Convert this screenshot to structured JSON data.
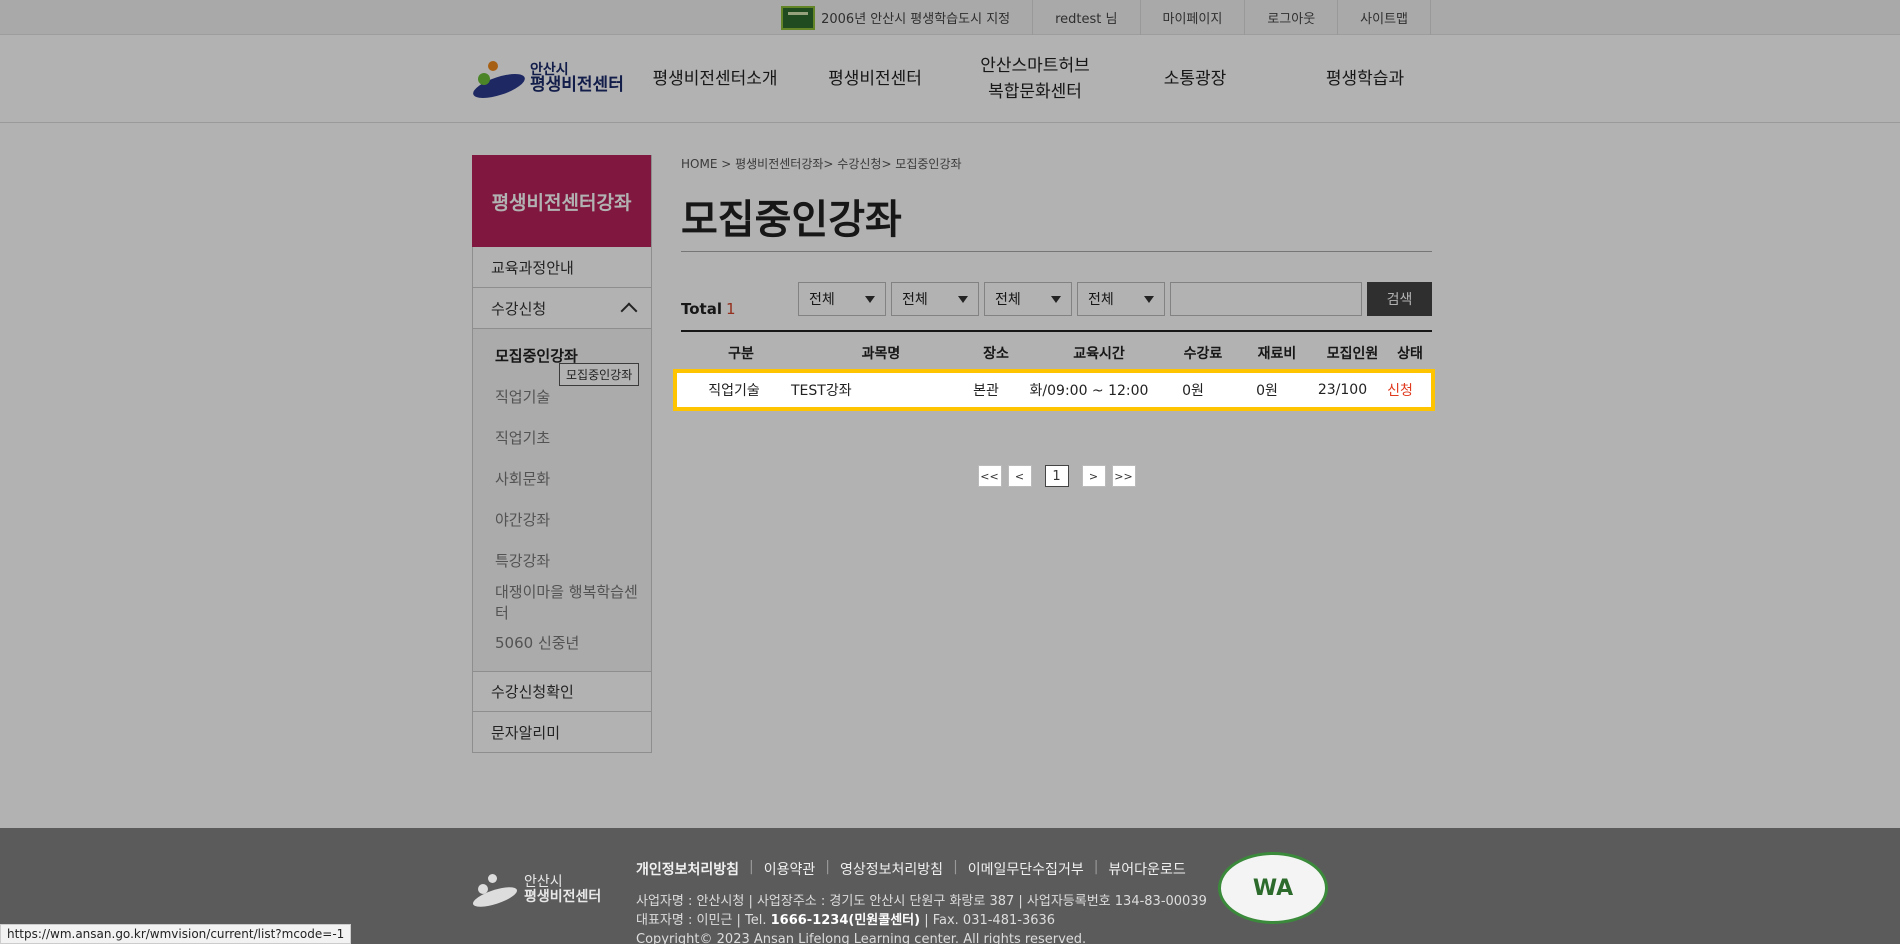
{
  "topbar": {
    "badge_text": "2006년 안산시 평생학습도시 지정",
    "user": "redtest 님",
    "mypage": "마이페이지",
    "logout": "로그아웃",
    "sitemap": "사이트맵"
  },
  "header": {
    "logo_small": "안산시",
    "logo_large": "평생비전센터",
    "nav": [
      "평생비전센터소개",
      "평생비전센터",
      "안산스마트허브",
      "복합문화센터",
      "소통광장",
      "평생학습과"
    ]
  },
  "sidebar": {
    "title": "평생비전센터강좌",
    "item_course_info": "교육과정안내",
    "item_enroll": "수강신청",
    "sub_items": [
      "모집중인강좌",
      "직업기술",
      "직업기초",
      "사회문화",
      "야간강좌",
      "특강강좌",
      "대쟁이마을 행복학습센터",
      "5060 신중년"
    ],
    "tooltip": "모집중인강좌",
    "item_enroll_check": "수강신청확인",
    "item_sms": "문자알리미"
  },
  "main": {
    "breadcrumb": "HOME > 평생비전센터강좌> 수강신청> 모집중인강좌",
    "title": "모집중인강좌",
    "total_label": "Total",
    "total_count": "1",
    "selects": [
      "전체",
      "전체",
      "전체",
      "전체"
    ],
    "search_label": "검색",
    "table_headers": [
      "구분",
      "과목명",
      "장소",
      "교육시간",
      "수강료",
      "재료비",
      "모집인원",
      "상태"
    ],
    "rows": [
      {
        "category": "직업기술",
        "name": "TEST강좌",
        "place": "본관",
        "time": "화/09:00 ~ 12:00",
        "fee": "0원",
        "material": "0원",
        "quota": "23/100",
        "status": "신청"
      }
    ],
    "pager": [
      "<<",
      "<",
      "1",
      ">",
      ">>"
    ]
  },
  "footer": {
    "logo_small": "안산시",
    "logo_large": "평생비전센터",
    "links": [
      "개인정보처리방침",
      "이용약관",
      "영상정보처리방침",
      "이메일무단수집거부",
      "뷰어다운로드"
    ],
    "line1": "사업자명 : 안산시청 | 사업장주소 : 경기도 안산시 단원구 화랑로 387 | 사업자등록번호 134-83-00039",
    "line2_a": "대표자명 : 이민근 | Tel. ",
    "line2_tel": "1666-1234(민원콜센터)",
    "line2_b": " | Fax. 031-481-3636",
    "line3": "Copyright© 2023 Ansan Lifelong Learning center. All rights reserved.",
    "wa_mark": "WA"
  },
  "status_url": "https://wm.ansan.go.kr/wmvision/current/list?mcode=-1"
}
